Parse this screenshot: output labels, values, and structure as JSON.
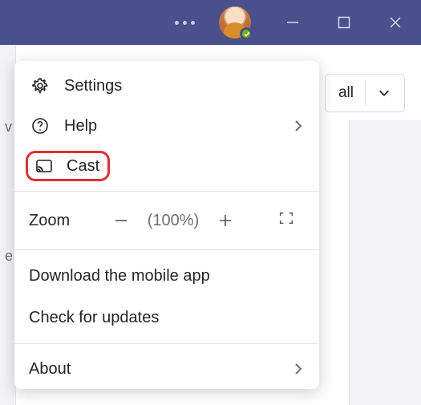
{
  "colors": {
    "titlebar": "#49508c",
    "highlight": "#e52f2f",
    "presence": "#6bb700"
  },
  "titlebar": {
    "more_tooltip": "More",
    "presence_state": "Available"
  },
  "background": {
    "call_button_fragment": "all",
    "left_strip_chars": [
      "v",
      "",
      "",
      "",
      "e"
    ]
  },
  "menu": {
    "settings": {
      "label": "Settings"
    },
    "help": {
      "label": "Help"
    },
    "cast": {
      "label": "Cast"
    },
    "zoom": {
      "label": "Zoom",
      "value_display": "(100%)",
      "value_percent": 100
    },
    "download": {
      "label": "Download the mobile app"
    },
    "check_updates": {
      "label": "Check for updates"
    },
    "about": {
      "label": "About"
    }
  }
}
